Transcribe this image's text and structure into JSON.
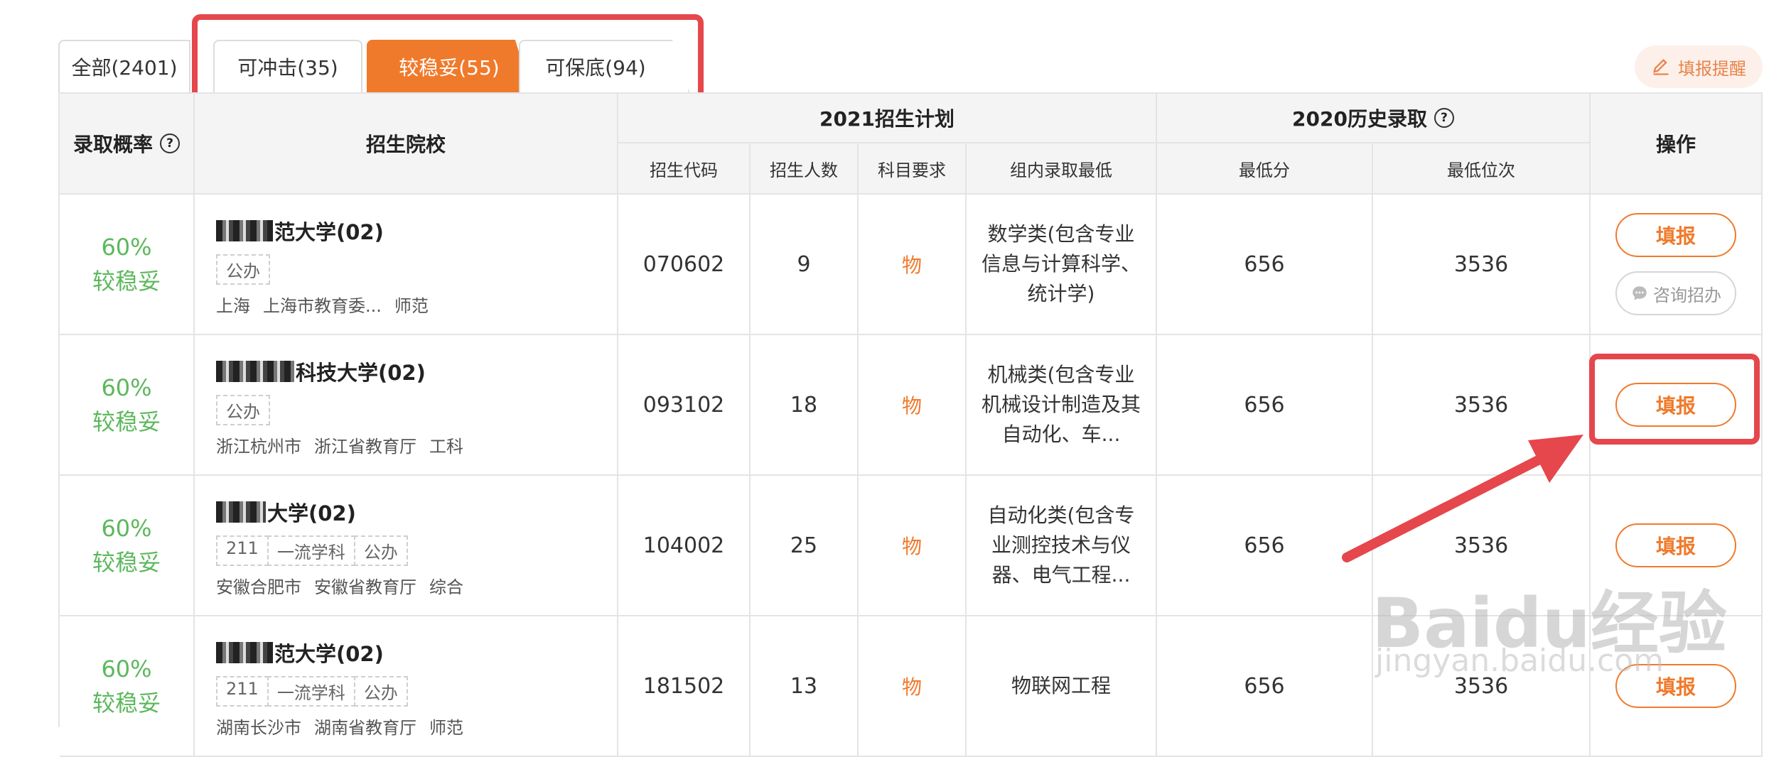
{
  "tabs": [
    {
      "label": "全部(2401)"
    },
    {
      "label": "可冲击(35)"
    },
    {
      "label": "较稳妥(55)"
    },
    {
      "label": "可保底(94)"
    }
  ],
  "remind_label": "填报提醒",
  "header": {
    "probability": "录取概率",
    "school": "招生院校",
    "plan_2021": "2021招生计划",
    "history_2020": "2020历史录取",
    "operation": "操作",
    "code": "招生代码",
    "count": "招生人数",
    "subject": "科目要求",
    "group_min": "组内录取最低",
    "min_score": "最低分",
    "min_rank": "最低位次"
  },
  "rows": [
    {
      "prob": "60%",
      "level": "较稳妥",
      "name": "范大学(02)",
      "tags": [
        "公办"
      ],
      "location": "上海",
      "authority": "上海市教育委...",
      "type": "师范",
      "code": "070602",
      "count": "9",
      "subject": "物",
      "major": "数学类(包含专业信息与计算科学、统计学)",
      "score": "656",
      "rank": "3536",
      "fill": "填报",
      "consult": "咨询招办"
    },
    {
      "prob": "60%",
      "level": "较稳妥",
      "name": "科技大学(02)",
      "tags": [
        "公办"
      ],
      "location": "浙江杭州市",
      "authority": "浙江省教育厅",
      "type": "工科",
      "code": "093102",
      "count": "18",
      "subject": "物",
      "major": "机械类(包含专业机械设计制造及其自动化、车...",
      "score": "656",
      "rank": "3536",
      "fill": "填报"
    },
    {
      "prob": "60%",
      "level": "较稳妥",
      "name": "大学(02)",
      "tags": [
        "211",
        "一流学科",
        "公办"
      ],
      "location": "安徽合肥市",
      "authority": "安徽省教育厅",
      "type": "综合",
      "code": "104002",
      "count": "25",
      "subject": "物",
      "major": "自动化类(包含专业测控技术与仪器、电气工程...",
      "score": "656",
      "rank": "3536",
      "fill": "填报"
    },
    {
      "prob": "60%",
      "level": "较稳妥",
      "name": "范大学(02)",
      "tags": [
        "211",
        "一流学科",
        "公办"
      ],
      "location": "湖南长沙市",
      "authority": "湖南省教育厅",
      "type": "师范",
      "code": "181502",
      "count": "13",
      "subject": "物",
      "major": "物联网工程",
      "score": "656",
      "rank": "3536",
      "fill": "填报"
    }
  ],
  "watermark": {
    "brand": "Baidu经验",
    "url": "jingyan.baidu.com"
  },
  "colors": {
    "accent": "#f07a2b",
    "probability": "#5cb85c",
    "annotation": "#e5474c"
  }
}
